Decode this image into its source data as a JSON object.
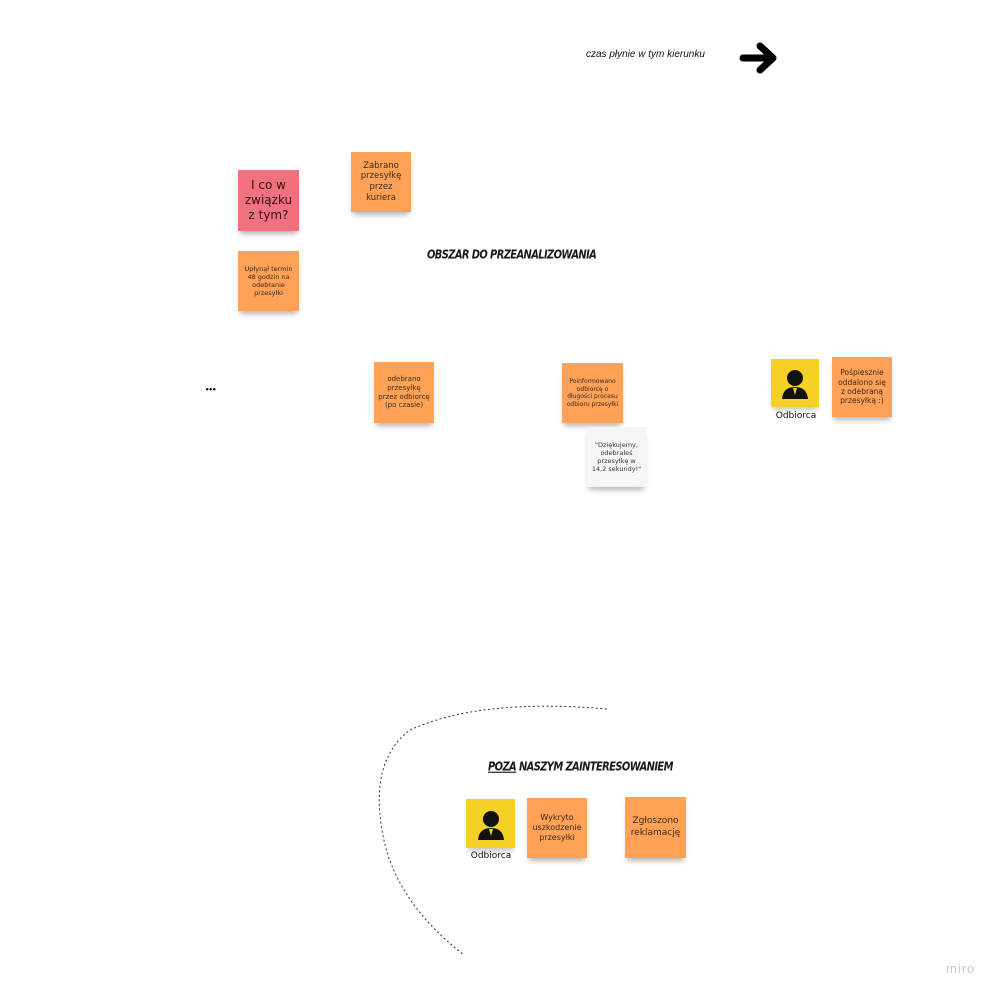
{
  "timeline": {
    "label": "czas płynie w tym kierunku",
    "arrow_icon": "arrow-right-icon"
  },
  "area_heading": "OBSZAR DO PRZEANALIZOWANIA",
  "outside_heading_underlined": "POZA",
  "outside_heading_rest": " NASZYM ZAINTERESOWANIEM",
  "ellipsis": "•••",
  "watermark": "miro",
  "stickies": {
    "question": "I co w związku z tym?",
    "courier_pickup": "Zabrano przesyłkę przez kuriera",
    "deadline": "Upłynął termin 48 godzin na odebranie przesyłki",
    "received": "odebrano przesyłkę przez odbiorcę (po czasie)",
    "informed": "Poinformowano odbiorcę o długości procesu odbioru przesyłki",
    "thanks": "\"Dziękujemy, odebrałeś przesyłkę w 14,2 sekundy!\"",
    "hurried": "Pośpiesznie oddalono się z odebraną przesyłką :)",
    "damage": "Wykryto uszkodzenie przesyłki",
    "complaint": "Zgłoszono reklamację"
  },
  "actors": [
    {
      "label": "Odbiorca",
      "icon": "person-icon"
    },
    {
      "label": "Odbiorca",
      "icon": "person-icon"
    }
  ],
  "colors": {
    "orange_sticky": "#ffa257",
    "pink_sticky": "#f1717f",
    "white_sticky": "#f6f6f6",
    "yellow_sticky": "#f5d128"
  }
}
